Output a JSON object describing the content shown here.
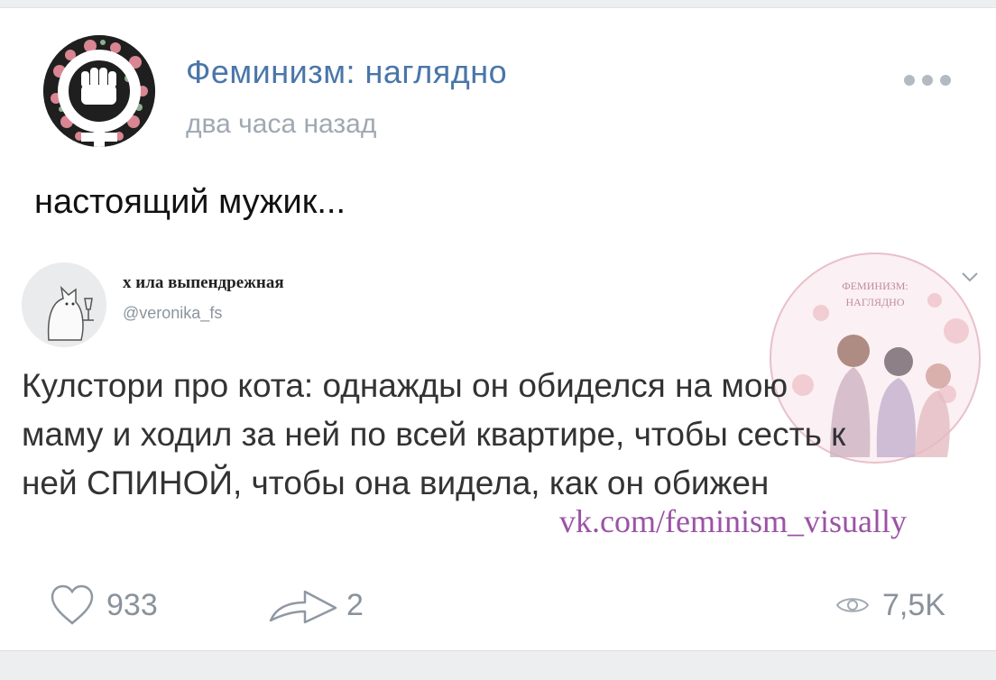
{
  "post": {
    "group_name": "Феминизм: наглядно",
    "time": "два часа назад",
    "text": "настоящий мужик..."
  },
  "tweet": {
    "name": "х ила выпендрежная",
    "handle": "@veronika_fs",
    "lines": [
      "Кулстори про кота: однажды он обиделся на мою",
      "маму и ходил за ней по всей квартире, чтобы сесть к",
      "ней СПИНОЙ, чтобы она видела, как он обижен"
    ]
  },
  "watermark": {
    "link": "vk.com/feminism_visually",
    "badge_top": "ФЕМИНИЗМ:",
    "badge_bottom": "НАГЛЯДНО"
  },
  "actions": {
    "likes": "933",
    "shares": "2",
    "views": "7,5K"
  },
  "icons": {
    "avatar": "feminist-fist-icon",
    "more": "ellipsis-icon",
    "like": "heart-icon",
    "share": "share-arrow-icon",
    "views": "eye-icon",
    "tweet_menu": "chevron-down-icon"
  },
  "colors": {
    "accent": "#4a76a8",
    "muted": "#a0a8b2",
    "watermark": "#9b52a6"
  }
}
